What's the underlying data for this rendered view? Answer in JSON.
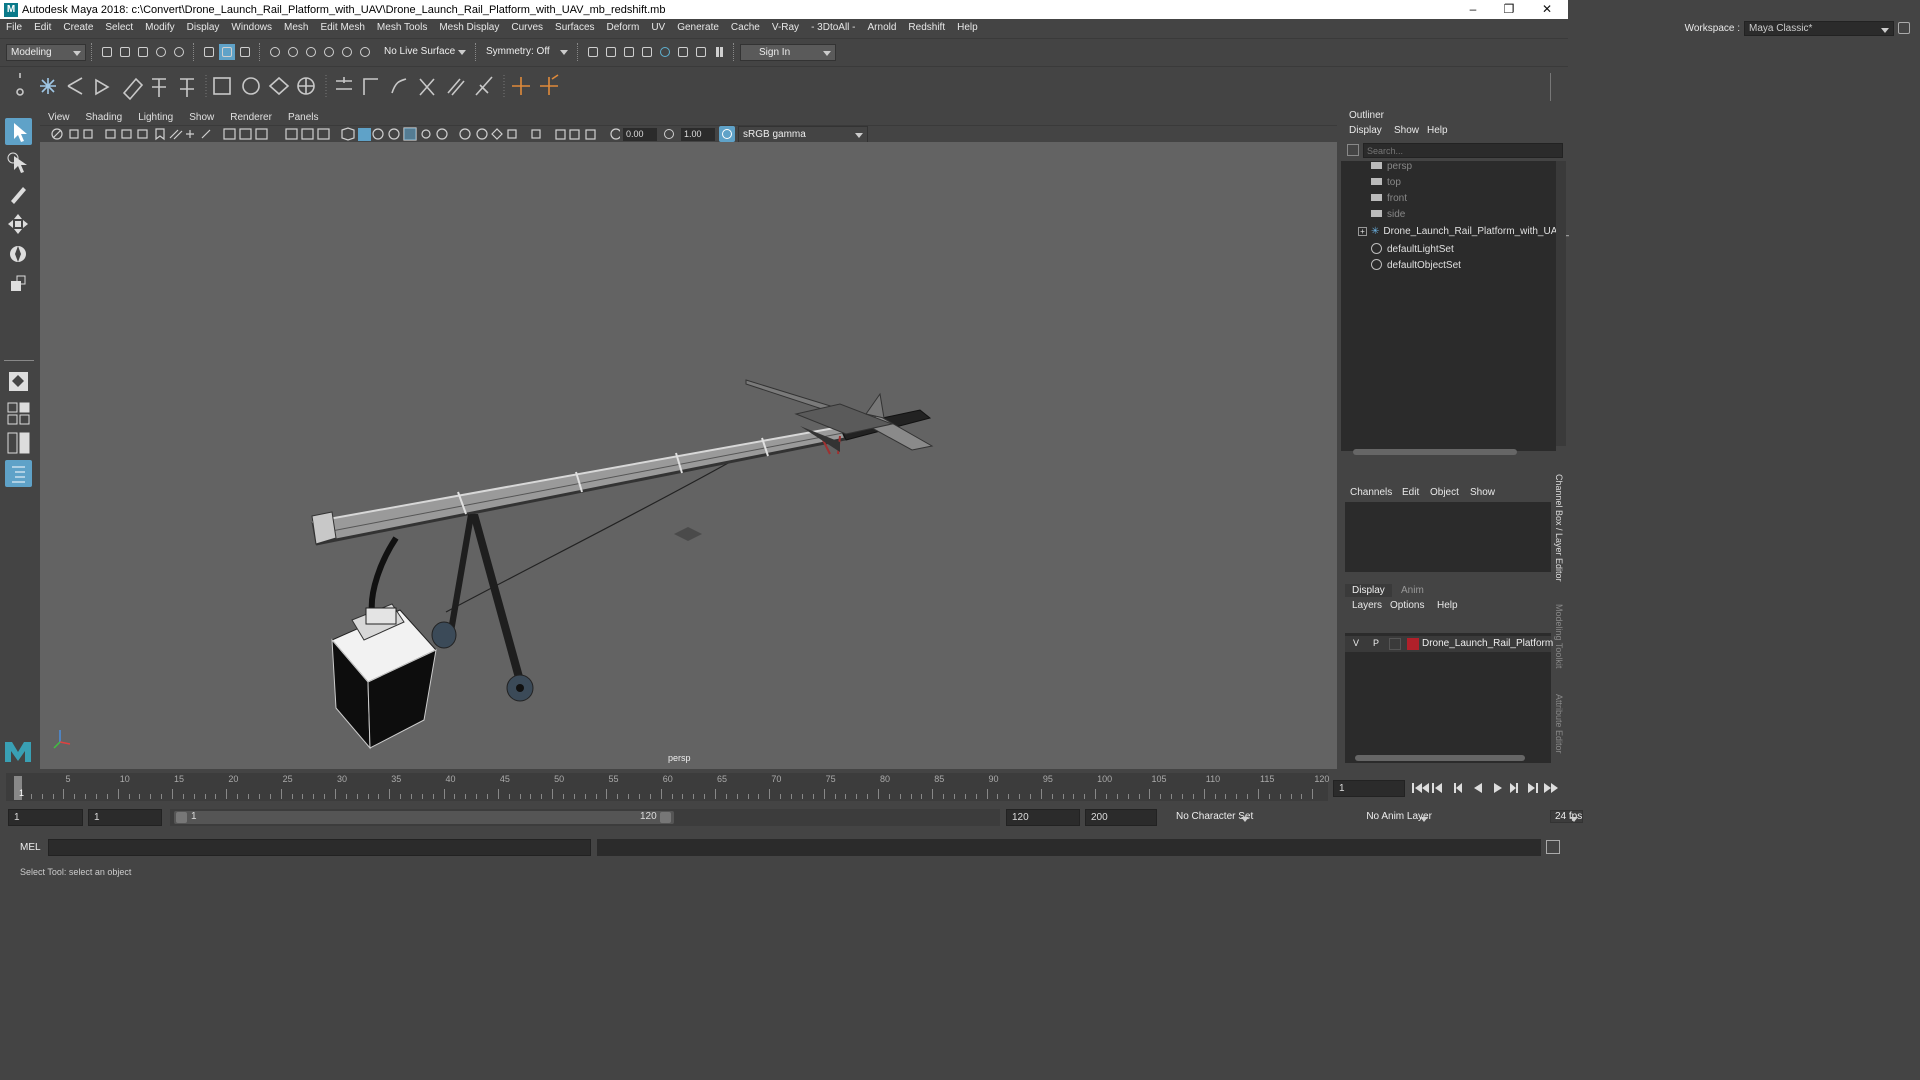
{
  "title_bar": {
    "text": "Autodesk Maya 2018: c:\\Convert\\Drone_Launch_Rail_Platform_with_UAV\\Drone_Launch_Rail_Platform_with_UAV_mb_redshift.mb",
    "minimize": "–",
    "maximize": "❐",
    "close": "✕"
  },
  "menu": [
    "File",
    "Edit",
    "Create",
    "Select",
    "Modify",
    "Display",
    "Windows",
    "Mesh",
    "Edit Mesh",
    "Mesh Tools",
    "Mesh Display",
    "Curves",
    "Surfaces",
    "Deform",
    "UV",
    "Generate",
    "Cache",
    "V-Ray",
    "- 3DtoAll -",
    "Arnold",
    "Redshift",
    "Help"
  ],
  "workspace": {
    "label": "Workspace :",
    "value": "Maya Classic*"
  },
  "status_line": {
    "mode": "Modeling",
    "live_surface": "No Live Surface",
    "symmetry": "Symmetry: Off",
    "sign_in": "Sign In"
  },
  "viewport": {
    "menu": [
      "View",
      "Shading",
      "Lighting",
      "Show",
      "Renderer",
      "Panels"
    ],
    "exposure": "0.00",
    "gamma": "1.00",
    "color_space": "sRGB gamma",
    "camera_label": "persp"
  },
  "outliner": {
    "title": "Outliner",
    "menu": [
      "Display",
      "Show",
      "Help"
    ],
    "search_placeholder": "Search...",
    "items": [
      {
        "label": "persp",
        "icon": "camera-icon",
        "dim": true
      },
      {
        "label": "top",
        "icon": "camera-icon",
        "dim": true
      },
      {
        "label": "front",
        "icon": "camera-icon",
        "dim": true
      },
      {
        "label": "side",
        "icon": "camera-icon",
        "dim": true
      },
      {
        "label": "Drone_Launch_Rail_Platform_with_UAV_",
        "icon": "group-icon",
        "dim": false
      },
      {
        "label": "defaultLightSet",
        "icon": "set-icon",
        "dim": false
      },
      {
        "label": "defaultObjectSet",
        "icon": "set-icon",
        "dim": false
      }
    ]
  },
  "channel_box": {
    "menu": [
      "Channels",
      "Edit",
      "Object",
      "Show"
    ],
    "side_tabs": [
      "Channel Box / Layer Editor",
      "Modeling Toolkit",
      "Attribute Editor"
    ]
  },
  "layer_editor": {
    "tabs": [
      "Display",
      "Anim"
    ],
    "menu": [
      "Layers",
      "Options",
      "Help"
    ],
    "layer": {
      "v": "V",
      "p": "P",
      "name": "Drone_Launch_Rail_Platform_w",
      "color": "#b0202a"
    }
  },
  "time_slider": {
    "ticks": [
      "5",
      "10",
      "15",
      "20",
      "25",
      "30",
      "35",
      "40",
      "45",
      "50",
      "55",
      "60",
      "65",
      "70",
      "75",
      "80",
      "85",
      "90",
      "95",
      "100",
      "105",
      "110",
      "115",
      "120"
    ],
    "current_frame_marker": "1",
    "current_frame": "1"
  },
  "range_slider": {
    "start": "1",
    "playback_start": "1",
    "range_start_label": "1",
    "range_end_label": "120",
    "playback_end": "120",
    "end": "200",
    "character_set": "No Character Set",
    "anim_layer": "No Anim Layer",
    "fps": "24 fps"
  },
  "command_line": {
    "label": "MEL"
  },
  "help_line": {
    "text": "Select Tool: select an object"
  },
  "colors": {
    "viewport_bg": "#636363",
    "panel_bg": "#444444",
    "field_bg": "#2b2b2b",
    "accent": "#5fa2c8"
  }
}
